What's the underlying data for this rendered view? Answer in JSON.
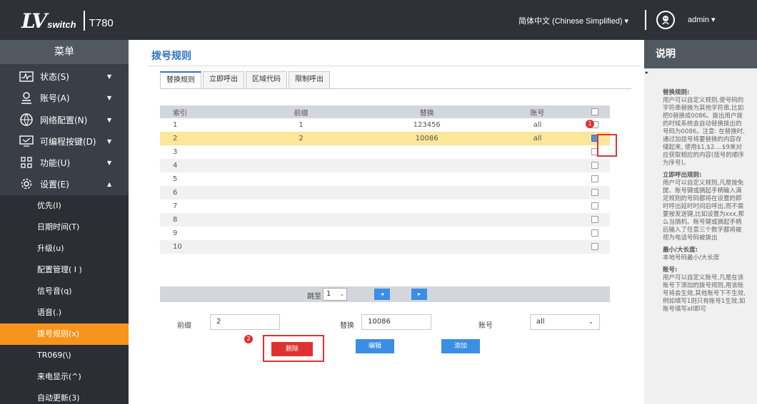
{
  "header": {
    "logo_mark": "LV",
    "logo_word": "switch",
    "model": "T780",
    "language": "简体中文 (Chinese Simplified) ▾",
    "user": "admin  ▾"
  },
  "sidebar": {
    "title": "菜单",
    "items": [
      {
        "label": "状态(S)",
        "icon": "status-icon"
      },
      {
        "label": "账号(A)",
        "icon": "account-icon"
      },
      {
        "label": "网络配置(N)",
        "icon": "network-icon"
      },
      {
        "label": "可编程按键(D)",
        "icon": "keyboard-icon"
      },
      {
        "label": "功能(U)",
        "icon": "grid-icon"
      },
      {
        "label": "设置(E)",
        "icon": "gear-icon"
      }
    ],
    "submenu": [
      "优先(I)",
      "日期时间(T)",
      "升级(u)",
      "配置管理( I )",
      "信号音(q)",
      "语音(.)",
      "拨号规则(x)",
      "TR069(\\)",
      "来电显示(^)",
      "自动更新(3)"
    ]
  },
  "main": {
    "title": "拨号规则",
    "tabs": [
      "替换规则",
      "立即呼出",
      "区域代码",
      "限制呼出"
    ],
    "table": {
      "columns": [
        "索引",
        "前缀",
        "替换",
        "账号"
      ],
      "rows": [
        {
          "index": "1",
          "prefix": "1",
          "replace": "123456",
          "account": "all",
          "checked": false
        },
        {
          "index": "2",
          "prefix": "2",
          "replace": "10086",
          "account": "all",
          "checked": true
        },
        {
          "index": "3",
          "prefix": "",
          "replace": "",
          "account": "",
          "checked": false
        },
        {
          "index": "4",
          "prefix": "",
          "replace": "",
          "account": "",
          "checked": false
        },
        {
          "index": "5",
          "prefix": "",
          "replace": "",
          "account": "",
          "checked": false
        },
        {
          "index": "6",
          "prefix": "",
          "replace": "",
          "account": "",
          "checked": false
        },
        {
          "index": "7",
          "prefix": "",
          "replace": "",
          "account": "",
          "checked": false
        },
        {
          "index": "8",
          "prefix": "",
          "replace": "",
          "account": "",
          "checked": false
        },
        {
          "index": "9",
          "prefix": "",
          "replace": "",
          "account": "",
          "checked": false
        },
        {
          "index": "10",
          "prefix": "",
          "replace": "",
          "account": "",
          "checked": false
        }
      ]
    },
    "pager": {
      "label": "跳至",
      "page": "1",
      "prev": "◂",
      "next": "▸"
    },
    "form": {
      "prefix_label": "前缀",
      "prefix_value": "2",
      "replace_label": "替换",
      "replace_value": "10086",
      "account_label": "账号",
      "account_value": "all"
    },
    "buttons": {
      "delete": "删除",
      "edit": "编辑",
      "add": "添加"
    },
    "badges": {
      "one": "1",
      "two": "2"
    }
  },
  "help": {
    "title": "说明",
    "bullet": "•",
    "sections": [
      {
        "heading": "替换规则:",
        "text": "用户可以自定义规则,使号码的字符串替换为其他字符串,比如把0替换成0086。拨出用户拨的时候系统会自动替换拨出的号码为0086。注意: 在替换时, 通过加括号将要替换的内容存储起来, 使用$1,$2....$9来对应获取相应的内容(括号的顺序为序号)。"
      },
      {
        "heading": "立即呼出规则:",
        "text": "用户可以自定义规则,凡是按免提、账号键或摘起手柄输入满足规则的号码都将在设置的即时呼出延时时间后呼出,而不需要按发送键,比如设置为xxx,那么当摘机、账号键或摘起手柄后输入了任意三个数字都将被视为电话号码被拨出"
      },
      {
        "heading": "最小/大长度:",
        "text": "本地号码最小/大长度"
      },
      {
        "heading": "账号:",
        "text": "用户可以自定义账号,凡是在该账号下添加的拨号规则,用该账号将会生效,其他账号下不生效,例如填写1则只有账号1生效,如账号填写all即可"
      }
    ]
  },
  "colors": {
    "topbar": "#2e3238",
    "sidebar": "#3a3f47",
    "active_menu": "#f7941d",
    "accent_blue": "#3a8ee6",
    "highlight_row": "#fbe69a",
    "annotation_red": "#e03131"
  }
}
